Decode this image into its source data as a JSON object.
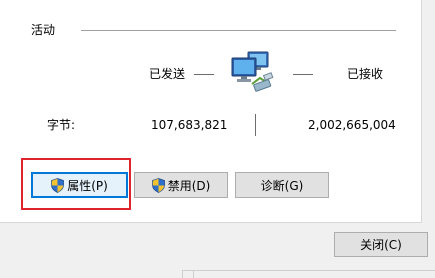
{
  "activity": {
    "section_title": "活动",
    "sent_label": "已发送",
    "received_label": "已接收",
    "bytes_label": "字节:",
    "bytes_sent": "107,683,821",
    "bytes_received": "2,002,665,004",
    "network_icon": "network-computers-icon"
  },
  "buttons": {
    "properties": "属性(P)",
    "disable": "禁用(D)",
    "diagnose": "诊断(G)",
    "close": "关闭(C)"
  },
  "colors": {
    "highlight": "#e0242b",
    "focus": "#0078d7"
  }
}
